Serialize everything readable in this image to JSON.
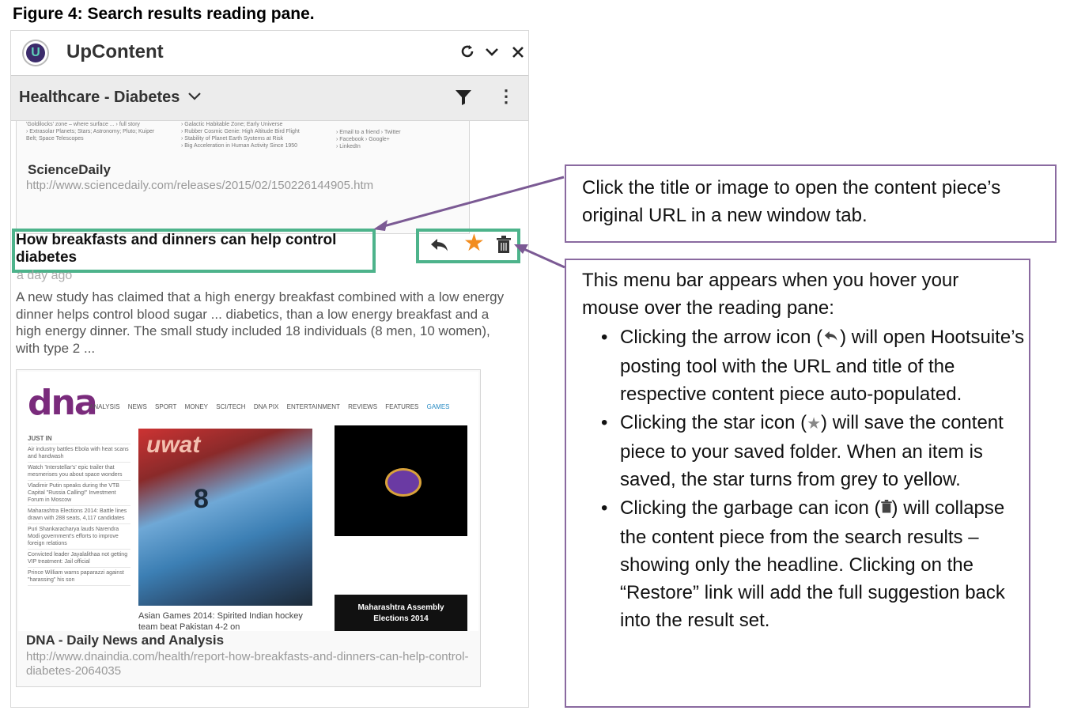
{
  "figure": {
    "title": "Figure 4: Search results reading pane."
  },
  "app": {
    "name": "UpContent",
    "logo_letter": "U"
  },
  "header_icons": {
    "refresh": "⟳",
    "collapse": "⌄",
    "close": "✕"
  },
  "stream": {
    "title": "Healthcare - Diabetes",
    "chevron": "⌄",
    "more": "⋮"
  },
  "card1": {
    "snippet_left": [
      "'Goldilocks' zone – where surface ... › full story",
      "› Extrasolar Planets; Stars; Astronomy; Pluto; Kuiper",
      "Belt; Space Telescopes"
    ],
    "snippet_mid": [
      "› Galactic Habitable Zone; Early Universe",
      "› Rubber Cosmic Genie: High Altitude Bird Flight",
      "› Stability of Planet Earth Systems at Risk",
      "› Big Acceleration in Human Activity Since 1950"
    ],
    "snippet_right": [
      "› Email to a friend    › Twitter",
      "› Facebook    › Google+",
      "› LinkedIn"
    ],
    "source": "ScienceDaily",
    "url": "http://www.sciencedaily.com/releases/2015/02/150226144905.htm"
  },
  "article": {
    "headline": "How breakfasts and dinners can help control diabetes",
    "time_ago": "a day ago",
    "summary": "A new study has claimed that a high energy breakfast combined with a low energy dinner helps control blood sugar ... diabetics, than a low energy breakfast and a high energy dinner. The small study included 18 individuals (8 men, 10 women), with type 2 ...",
    "menu": {
      "reply": "↰",
      "star": "★",
      "trash": "🗑"
    },
    "source": "DNA - Daily News and Analysis",
    "url": "http://www.dnaindia.com/health/report-how-breakfasts-and-dinners-can-help-control-diabetes-2064035"
  },
  "dna_page": {
    "logo": "dna",
    "nav": [
      "ANALYSIS",
      "NEWS",
      "SPORT",
      "MONEY",
      "SCI/TECH",
      "DNA PIX",
      "ENTERTAINMENT",
      "REVIEWS",
      "FEATURES",
      "GAMES"
    ],
    "side_heading": "JUST IN",
    "side_items": [
      "Air industry battles Ebola with heat scans and handwash",
      "Watch 'Interstellar's' epic trailer that mesmerises you about space wonders",
      "Vladimir Putin speaks during the VTB Capital \"Russia Calling!\" Investment Forum in Moscow",
      "Maharashtra Elections 2014: Battle lines drawn with 288 seats, 4,117 candidates",
      "Puri Shankaracharya lauds Narendra Modi government's efforts to improve foreign relations",
      "Convicted leader Jayalalithaa not getting VIP treatment: Jail official",
      "Prince William warns paparazzi against \"harassing\" his son"
    ],
    "photo_text": "uwat",
    "photo_number": "8",
    "caption": "Asian Games 2014: Spirited Indian hockey team beat Pakistan 4-2 on",
    "ad_line1": "Maharashtra Assembly",
    "ad_line2": "Elections 2014"
  },
  "callout1": {
    "text": "Click the title or image to open the content piece’s original URL in a new window tab."
  },
  "callout2": {
    "intro": "This menu bar appears when you hover your mouse over the reading pane:",
    "b1_pre": "Clicking the arrow icon (",
    "b1_post": ") will open Hootsuite’s posting tool with the URL and title of the respective content piece auto-populated.",
    "b2_pre": "Clicking the star icon (",
    "b2_post": ") will save the content piece to your saved folder. When an item is saved, the star turns from grey to yellow.",
    "b3_pre": "Clicking the garbage can icon (",
    "b3_post": ") will collapse the content piece from the search results – showing only the headline. Clicking on the “Restore” link will add the full suggestion back into the result set."
  },
  "colors": {
    "highlight": "#4db38b",
    "arrow": "#7b5a94",
    "star": "#f28c1e"
  }
}
